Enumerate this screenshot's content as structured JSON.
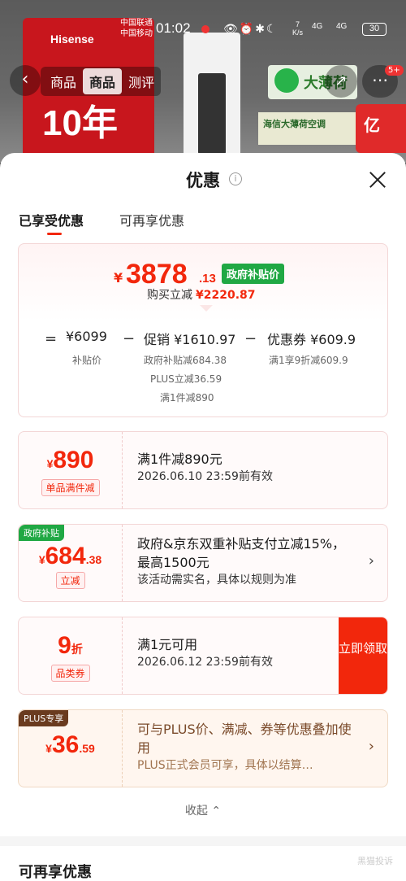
{
  "status_bar": {
    "carrier1": "中国联通",
    "carrier2": "中国移动",
    "time": "01:02",
    "net_speed_value": "7",
    "net_speed_unit": "K/s",
    "sig1": "4G",
    "sig2": "4G",
    "battery": "30"
  },
  "background": {
    "brand": "Hisense",
    "tenyear": "10年",
    "tabs": [
      "商品",
      "测评"
    ],
    "logo_text": "大薄荷",
    "green_text": "海信大薄荷空调",
    "red_text": "亿",
    "badge": "5+"
  },
  "sheet": {
    "title": "优惠",
    "tabs": {
      "active": "已享受优惠",
      "inactive": "可再享优惠"
    }
  },
  "summary": {
    "currency": "¥",
    "price_int": "3878",
    "price_dec": ".13",
    "price_tag": "政府补贴价",
    "reduce_label": "购买立减",
    "reduce_value": "¥2220.87",
    "base_amount": "¥6099",
    "base_label": "补贴价",
    "promo_amount": "促销 ¥1610.97",
    "promo_details": [
      "政府补贴减684.38",
      "PLUS立减36.59",
      "满1件减890"
    ],
    "coupon_amount": "优惠券 ¥609.9",
    "coupon_detail": "满1享9折减609.9"
  },
  "coupons": [
    {
      "currency": "¥",
      "value": "890",
      "type": "单品满件减",
      "title": "满1件减890元",
      "sub": "2026.06.10 23:59前有效"
    },
    {
      "ribbon": "政府补贴",
      "currency": "¥",
      "value": "684",
      "decimal": ".38",
      "type": "立减",
      "title": "政府&京东双重补贴支付立减15%，最高1500元",
      "sub": "该活动需实名，具体以规则为准"
    },
    {
      "value": "9",
      "suffix": "折",
      "type": "品类券",
      "title": "满1元可用",
      "sub": "2026.06.12 23:59前有效",
      "claim": "立即领取"
    },
    {
      "ribbon": "PLUS专享",
      "currency": "¥",
      "value": "36",
      "decimal": ".59",
      "title": "可与PLUS价、满减、券等优惠叠加使用",
      "sub": "PLUS正式会员可享，具体以结算…"
    }
  ],
  "collapse_label": "收起",
  "section2_title": "可再享优惠",
  "watermark": "黑猫投诉",
  "colors": {
    "accent": "#f2270c",
    "gov_green": "#20a844",
    "plus_brown": "#6a3b1f"
  }
}
